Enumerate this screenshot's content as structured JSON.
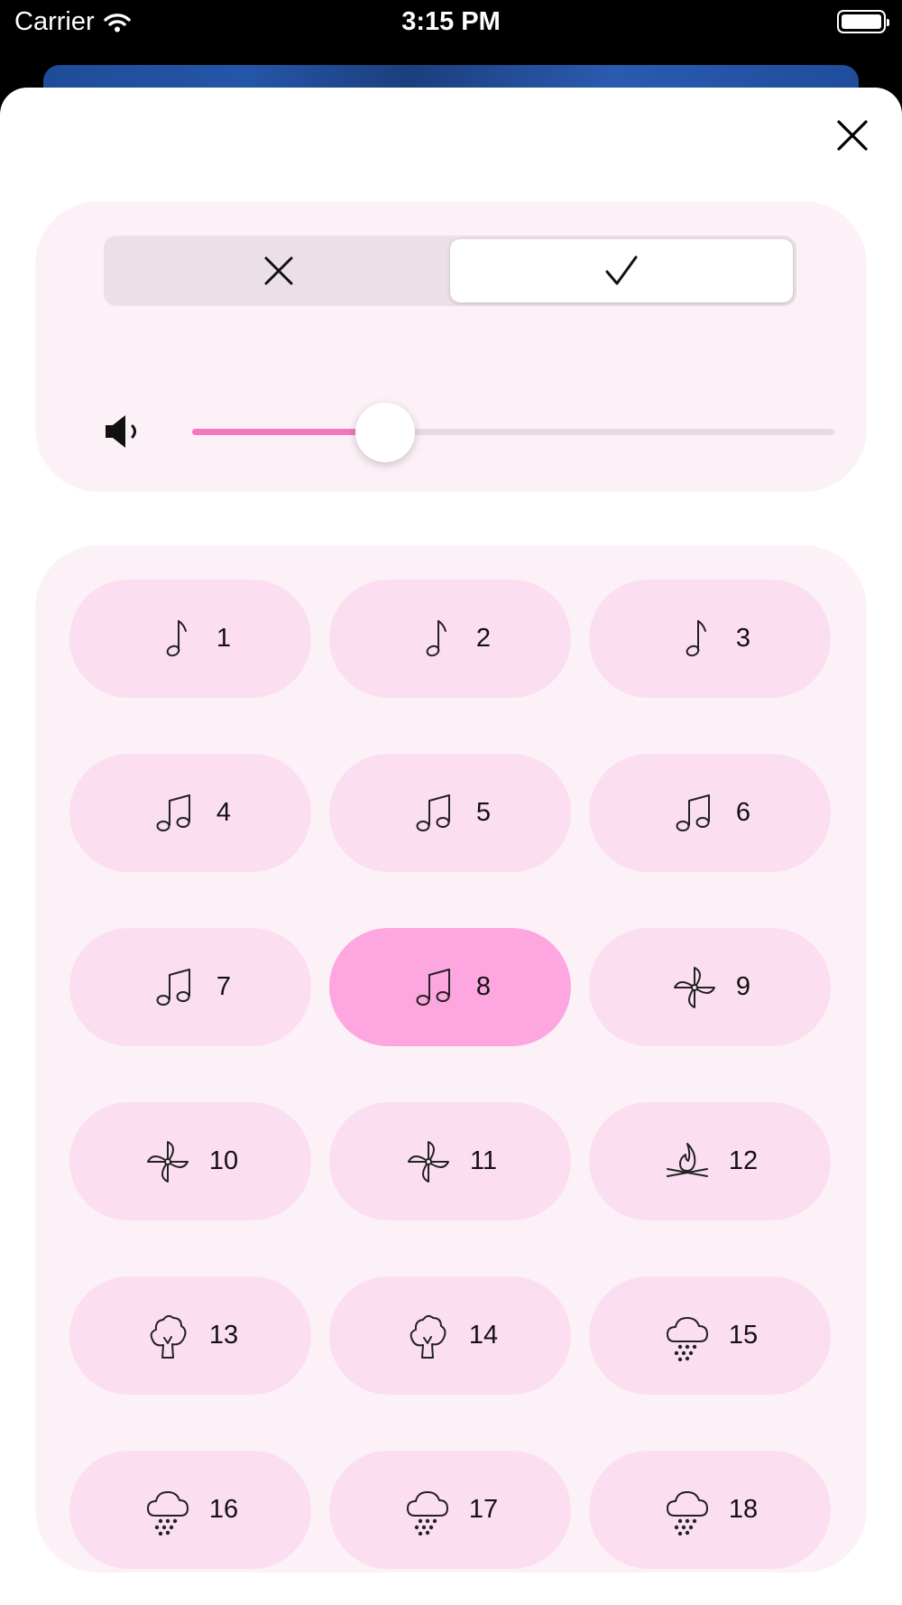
{
  "status_bar": {
    "carrier": "Carrier",
    "time": "3:15 PM"
  },
  "segmented": {
    "options": [
      {
        "icon": "xmark-icon",
        "selected": false
      },
      {
        "icon": "checkmark-icon",
        "selected": true
      }
    ]
  },
  "volume": {
    "icon": "speaker-icon",
    "level": 0.3
  },
  "colors": {
    "accent": "#f576c4",
    "button_bg": "#fcdef1",
    "button_active": "#fda6e0",
    "card_bg": "#fdf1f8"
  },
  "sounds": [
    {
      "label": "1",
      "icon": "music-note-icon",
      "active": false
    },
    {
      "label": "2",
      "icon": "music-note-icon",
      "active": false
    },
    {
      "label": "3",
      "icon": "music-note-icon",
      "active": false
    },
    {
      "label": "4",
      "icon": "music-notes-icon",
      "active": false
    },
    {
      "label": "5",
      "icon": "music-notes-icon",
      "active": false
    },
    {
      "label": "6",
      "icon": "music-notes-icon",
      "active": false
    },
    {
      "label": "7",
      "icon": "music-notes-icon",
      "active": false
    },
    {
      "label": "8",
      "icon": "music-notes-icon",
      "active": true
    },
    {
      "label": "9",
      "icon": "pinwheel-icon",
      "active": false
    },
    {
      "label": "10",
      "icon": "pinwheel-icon",
      "active": false
    },
    {
      "label": "11",
      "icon": "pinwheel-icon",
      "active": false
    },
    {
      "label": "12",
      "icon": "campfire-icon",
      "active": false
    },
    {
      "label": "13",
      "icon": "tree-icon",
      "active": false
    },
    {
      "label": "14",
      "icon": "tree-icon",
      "active": false
    },
    {
      "label": "15",
      "icon": "rain-cloud-icon",
      "active": false
    },
    {
      "label": "16",
      "icon": "rain-cloud-icon",
      "active": false
    },
    {
      "label": "17",
      "icon": "rain-cloud-icon",
      "active": false
    },
    {
      "label": "18",
      "icon": "rain-cloud-icon",
      "active": false
    }
  ]
}
